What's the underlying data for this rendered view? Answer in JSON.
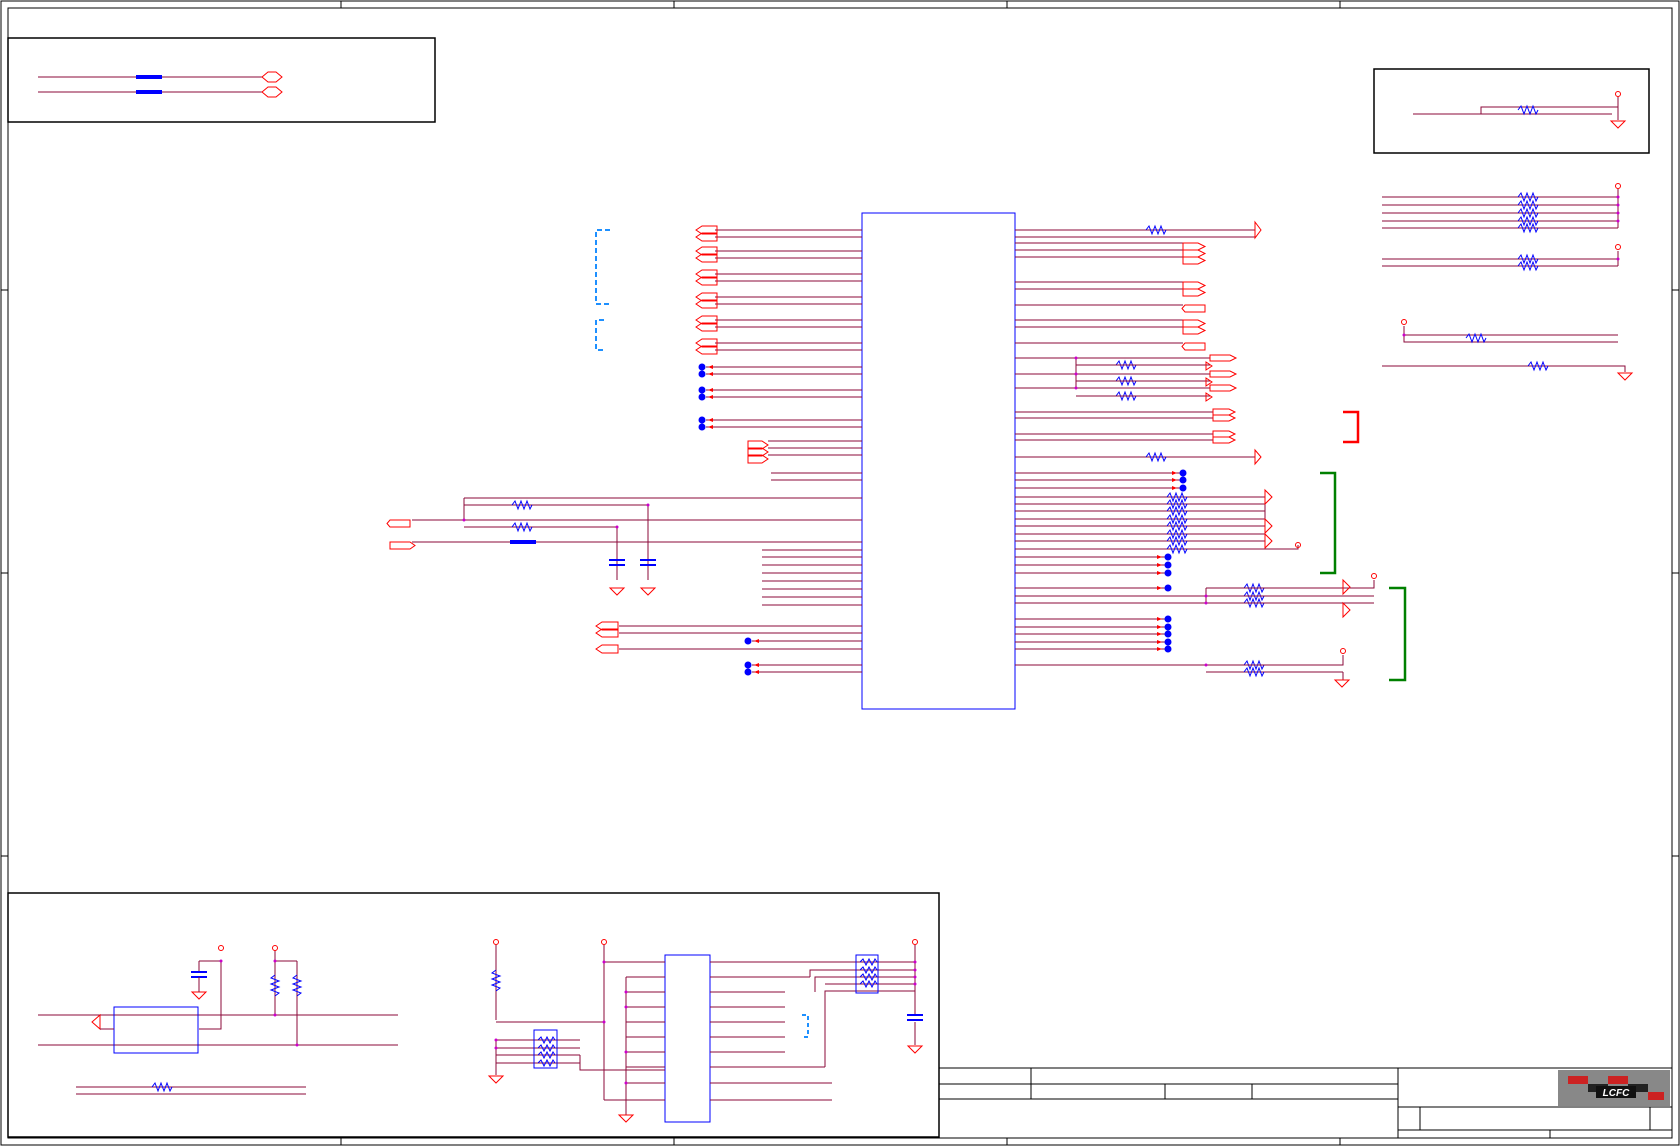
{
  "sheet": {
    "type": "electrical schematic",
    "colors": {
      "background": "#ffffff",
      "border": "#000000",
      "wire": "#8b0a3a",
      "component": "#0000ff",
      "connector": "#ff0000",
      "junction": "#cc00cc",
      "dashed_bracket": "#1e90ff",
      "red_bracket": "#ff0000",
      "green_bracket": "#008000"
    }
  },
  "title_block": {
    "logo_text": "LCFC"
  }
}
